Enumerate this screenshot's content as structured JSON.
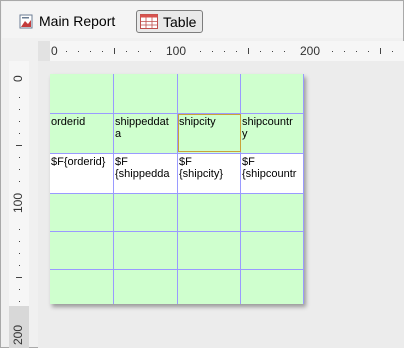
{
  "tabs": [
    {
      "label": "Main Report",
      "icon": "report-icon"
    },
    {
      "label": "Table",
      "icon": "table-icon",
      "active": true
    }
  ],
  "ruler": {
    "horizontal_labels": [
      "0",
      "100",
      "200"
    ],
    "vertical_labels": [
      "0",
      "100",
      "200"
    ]
  },
  "table": {
    "columns": 4,
    "header_row": [
      "orderid",
      "shippeddat\na",
      "shipcity",
      "shipcountr\ny"
    ],
    "detail_row": [
      "$F{orderid}",
      "$F\n{shippedda",
      "$F\n{shipcity}",
      "$F\n{shipcountr"
    ],
    "selected_cell": "shipcity"
  },
  "colors": {
    "cell_fill": "#cfffce",
    "grid_line": "#9a9aff",
    "selection": "#caa23a"
  }
}
